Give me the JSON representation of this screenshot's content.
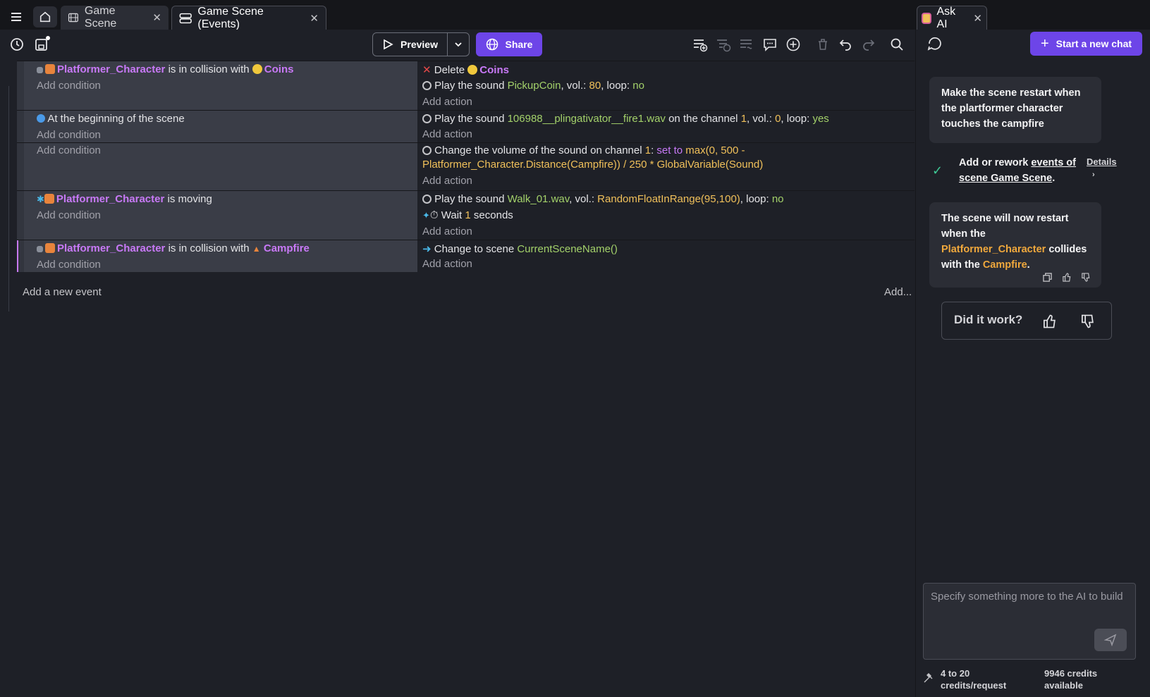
{
  "tabs": {
    "game_scene": "Game Scene",
    "game_scene_events": "Game Scene (Events)",
    "ask_ai": "Ask AI"
  },
  "toolbar": {
    "preview": "Preview",
    "share": "Share",
    "add_more": "Add..."
  },
  "events": [
    {
      "cond_object": "Platformer_Character",
      "cond_text": "is in collision with",
      "cond_target": "Coins",
      "add_condition": "Add condition",
      "actions": {
        "a1_verb": "Delete",
        "a1_obj": "Coins",
        "a2_prefix": "Play the sound",
        "a2_file": "PickupCoin",
        "a2_vol_label": ", vol.:",
        "a2_vol": "80",
        "a2_loop_label": ", loop:",
        "a2_loop": "no",
        "add_action": "Add action"
      }
    },
    {
      "cond_text": "At the beginning of the scene",
      "add_condition": "Add condition",
      "actions": {
        "a1_prefix": "Play the sound",
        "a1_file": "106988__plingativator__fire1.wav",
        "a1_channel_label": "on the channel",
        "a1_channel": "1",
        "a1_vol_label": ", vol.:",
        "a1_vol": "0",
        "a1_loop_label": ", loop:",
        "a1_loop": "yes",
        "add_action": "Add action"
      }
    },
    {
      "add_condition": "Add condition",
      "actions": {
        "a1_prefix": "Change the volume of the sound on channel",
        "a1_channel": "1",
        "a1_colon": ":",
        "a1_op": "set to",
        "a1_expr1": "max(0, 500 -",
        "a1_expr2": "Platformer_Character.Distance(Campfire)) / 250 * GlobalVariable(Sound)",
        "add_action": "Add action"
      }
    },
    {
      "cond_object": "Platformer_Character",
      "cond_text": "is moving",
      "add_condition": "Add condition",
      "actions": {
        "a1_prefix": "Play the sound",
        "a1_file": "Walk_01.wav",
        "a1_vol_label": ", vol.:",
        "a1_vol": "RandomFloatInRange(95,100)",
        "a1_loop_label": ", loop:",
        "a1_loop": "no",
        "a2_prefix": "Wait",
        "a2_val": "1",
        "a2_unit": "seconds",
        "add_action": "Add action"
      }
    },
    {
      "cond_object": "Platformer_Character",
      "cond_text": "is in collision with",
      "cond_target": "Campfire",
      "add_condition": "Add condition",
      "actions": {
        "a1_prefix": "Change to scene",
        "a1_val": "CurrentSceneName()",
        "add_action": "Add action"
      }
    }
  ],
  "add_new_event": "Add a new event",
  "chat": {
    "new_chat": "Start a new chat",
    "user_msg": "Make the scene restart when the plartformer character touches the campfire",
    "tool_prefix": "Add or rework",
    "tool_link": "events of scene Game Scene",
    "tool_suffix": ".",
    "details": "Details",
    "ai_msg_1": "The scene will now restart when the",
    "ai_msg_obj": "Platformer_Character",
    "ai_msg_2": "collides with the",
    "ai_msg_obj2": "Campfire",
    "ai_msg_3": ".",
    "did_it_work": "Did it work?",
    "input_placeholder": "Specify something more to the AI to build",
    "credits_request": "4 to 20 credits/request",
    "credits_available": "9946 credits available"
  },
  "colors": {
    "accent": "#6d45e8",
    "object": "#c879f7",
    "string": "#a3d16a",
    "number": "#f0c05a"
  }
}
